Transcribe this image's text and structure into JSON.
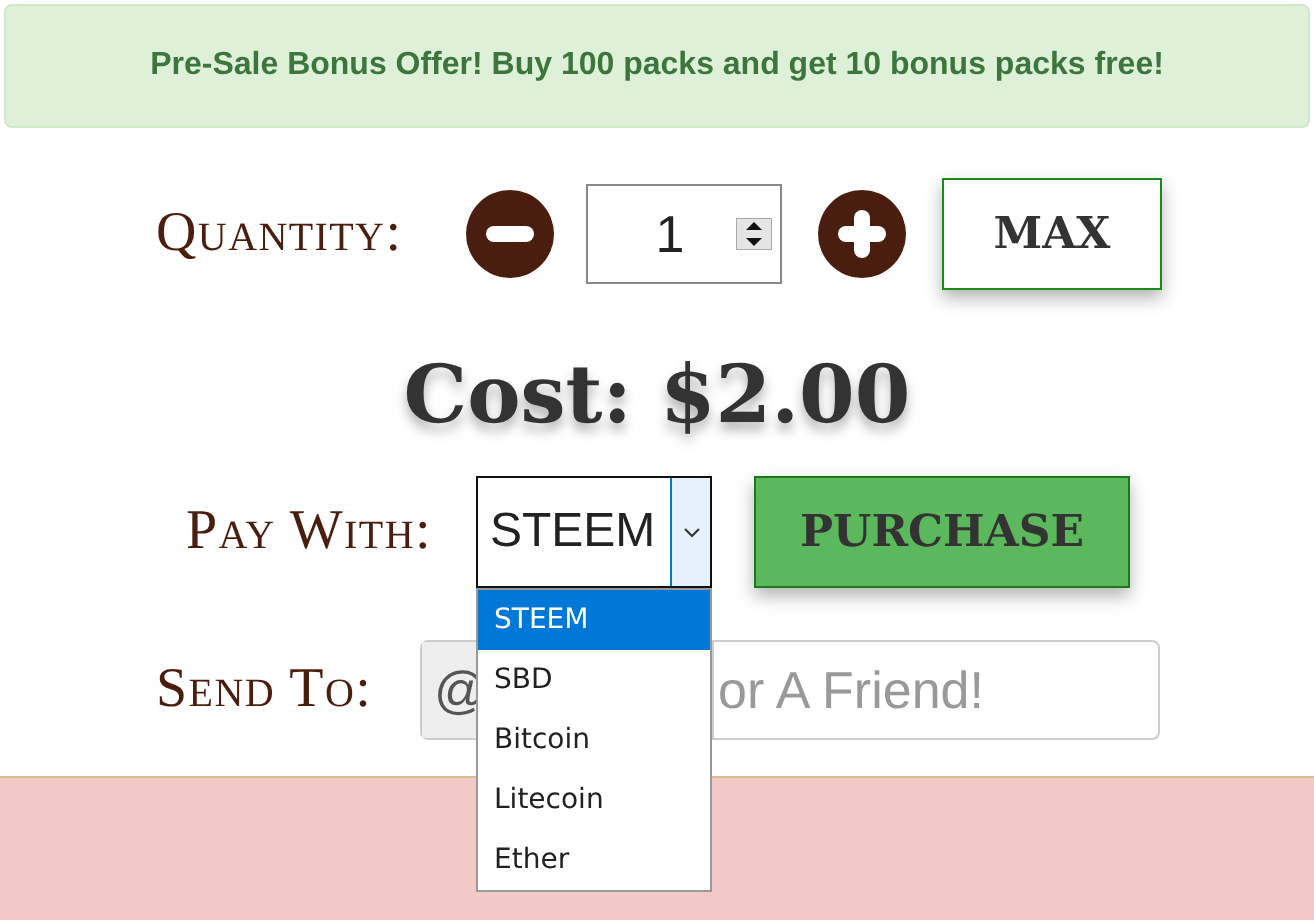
{
  "banner": "Pre-Sale Bonus Offer! Buy 100 packs and get 10 bonus packs free!",
  "quantity": {
    "label": "Quantity:",
    "value": "1",
    "max_button": "MAX"
  },
  "cost": "Cost: $2.00",
  "pay_with": {
    "label": "Pay With:",
    "value": "STEEM",
    "expanded": true,
    "options": [
      {
        "label": "STEEM",
        "selected": true
      },
      {
        "label": "SBD",
        "selected": false
      },
      {
        "label": "Bitcoin",
        "selected": false
      },
      {
        "label": "Litecoin",
        "selected": false
      },
      {
        "label": "Ether",
        "selected": false
      }
    ]
  },
  "purchase_button": "PURCHASE",
  "send_to": {
    "label": "Send To:",
    "addon": "@",
    "placeholder": "or A Friend!"
  }
}
